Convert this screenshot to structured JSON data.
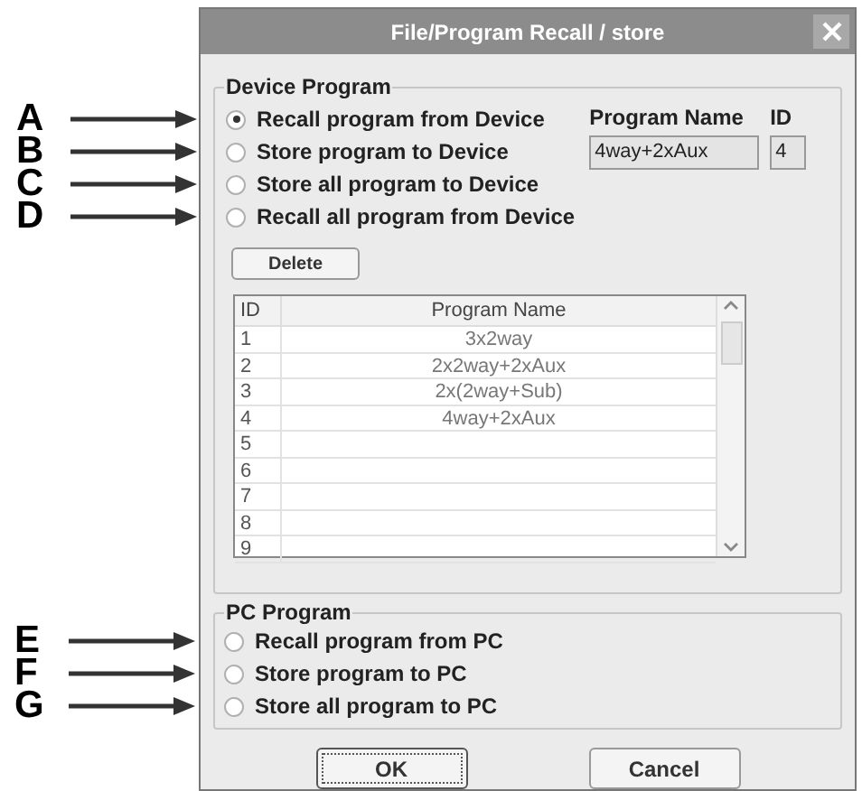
{
  "window": {
    "title": "File/Program Recall / store"
  },
  "device_program": {
    "title": "Device Program",
    "options": [
      {
        "label": "Recall program from Device",
        "selected": true,
        "callout": "A"
      },
      {
        "label": "Store program to Device",
        "selected": false,
        "callout": "B"
      },
      {
        "label": "Store all program to Device",
        "selected": false,
        "callout": "C"
      },
      {
        "label": "Recall all program from Device",
        "selected": false,
        "callout": "D"
      }
    ],
    "program_name_label": "Program Name",
    "id_label": "ID",
    "program_name_value": "4way+2xAux",
    "id_value": "4",
    "delete_button": "Delete",
    "table": {
      "columns": [
        "ID",
        "Program Name"
      ],
      "rows": [
        {
          "id": "1",
          "name": "3x2way"
        },
        {
          "id": "2",
          "name": "2x2way+2xAux"
        },
        {
          "id": "3",
          "name": "2x(2way+Sub)"
        },
        {
          "id": "4",
          "name": "4way+2xAux"
        },
        {
          "id": "5"
        },
        {
          "id": "6"
        },
        {
          "id": "7"
        },
        {
          "id": "8"
        },
        {
          "id": "9"
        }
      ]
    }
  },
  "pc_program": {
    "title": "PC Program",
    "options": [
      {
        "label": "Recall program from PC",
        "selected": false,
        "callout": "E"
      },
      {
        "label": "Store program to PC",
        "selected": false,
        "callout": "F"
      },
      {
        "label": "Store all program to PC",
        "selected": false,
        "callout": "G"
      }
    ]
  },
  "buttons": [
    {
      "label": "OK",
      "default": true
    },
    {
      "label": "Cancel",
      "default": false
    }
  ]
}
